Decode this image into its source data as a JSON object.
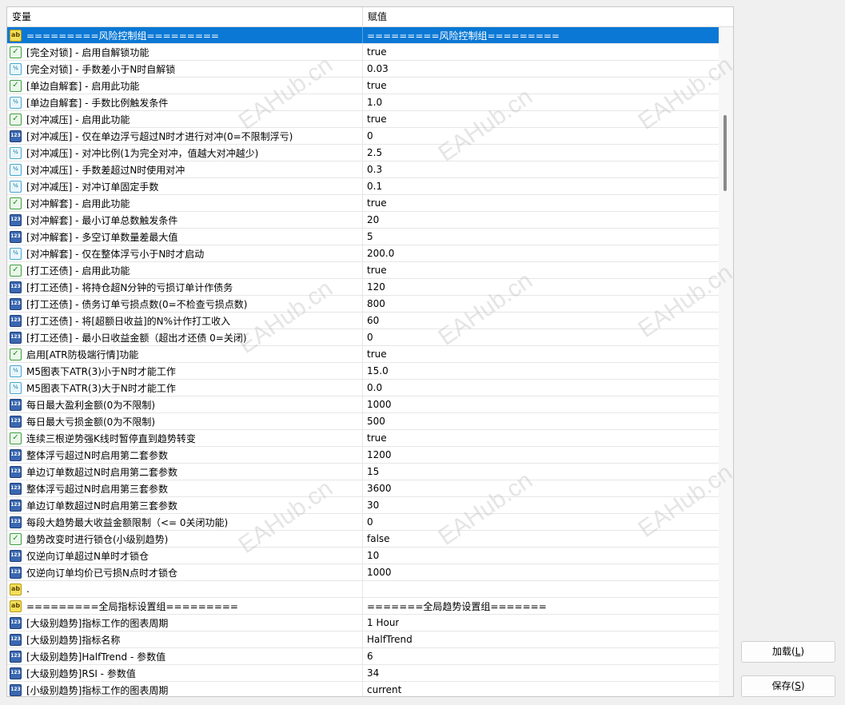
{
  "table": {
    "col_name": "变量",
    "col_value": "赋值",
    "rows": [
      {
        "icon": "ab",
        "name": "=========风险控制组=========",
        "value": "=========风险控制组=========",
        "selected": true
      },
      {
        "icon": "bool",
        "name": "[完全对锁] - 启用自解锁功能",
        "value": "true"
      },
      {
        "icon": "dbl",
        "name": "[完全对锁] - 手数差小于N时自解锁",
        "value": "0.03"
      },
      {
        "icon": "bool",
        "name": "[单边自解套] - 启用此功能",
        "value": "true"
      },
      {
        "icon": "dbl",
        "name": "[单边自解套] - 手数比例触发条件",
        "value": "1.0"
      },
      {
        "icon": "bool",
        "name": "[对冲减压] - 启用此功能",
        "value": "true"
      },
      {
        "icon": "num",
        "name": "[对冲减压] - 仅在单边浮亏超过N时才进行对冲(0=不限制浮亏)",
        "value": "0"
      },
      {
        "icon": "dbl",
        "name": "[对冲减压] - 对冲比例(1为完全对冲，值越大对冲越少)",
        "value": "2.5"
      },
      {
        "icon": "dbl",
        "name": "[对冲减压] - 手数差超过N时使用对冲",
        "value": "0.3"
      },
      {
        "icon": "dbl",
        "name": "[对冲减压] - 对冲订单固定手数",
        "value": "0.1"
      },
      {
        "icon": "bool",
        "name": "[对冲解套] - 启用此功能",
        "value": "true"
      },
      {
        "icon": "num",
        "name": "[对冲解套] - 最小订单总数触发条件",
        "value": "20"
      },
      {
        "icon": "num",
        "name": "[对冲解套] - 多空订单数量差最大值",
        "value": "5"
      },
      {
        "icon": "dbl",
        "name": "[对冲解套] - 仅在整体浮亏小于N时才启动",
        "value": "200.0"
      },
      {
        "icon": "bool",
        "name": "[打工还债] - 启用此功能",
        "value": "true"
      },
      {
        "icon": "num",
        "name": "[打工还债] - 将持仓超N分钟的亏损订单计作债务",
        "value": "120"
      },
      {
        "icon": "num",
        "name": "[打工还债] - 债务订单亏损点数(0=不检查亏损点数)",
        "value": "800"
      },
      {
        "icon": "num",
        "name": "[打工还债] - 将[超额日收益]的N%计作打工收入",
        "value": "60"
      },
      {
        "icon": "num",
        "name": "[打工还债] - 最小日收益金额（超出才还债 0=关闭)",
        "value": "0"
      },
      {
        "icon": "bool",
        "name": "启用[ATR防极端行情]功能",
        "value": "true"
      },
      {
        "icon": "dbl",
        "name": "M5图表下ATR(3)小于N时才能工作",
        "value": "15.0"
      },
      {
        "icon": "dbl",
        "name": "M5图表下ATR(3)大于N时才能工作",
        "value": "0.0"
      },
      {
        "icon": "num",
        "name": "每日最大盈利金额(0为不限制)",
        "value": "1000"
      },
      {
        "icon": "num",
        "name": "每日最大亏损金额(0为不限制)",
        "value": "500"
      },
      {
        "icon": "bool",
        "name": "连续三根逆势强K线时暂停直到趋势转变",
        "value": "true"
      },
      {
        "icon": "num",
        "name": "整体浮亏超过N时启用第二套参数",
        "value": "1200"
      },
      {
        "icon": "num",
        "name": "单边订单数超过N时启用第二套参数",
        "value": "15"
      },
      {
        "icon": "num",
        "name": "整体浮亏超过N时启用第三套参数",
        "value": "3600"
      },
      {
        "icon": "num",
        "name": "单边订单数超过N时启用第三套参数",
        "value": "30"
      },
      {
        "icon": "num",
        "name": "每段大趋势最大收益金额限制（<= 0关闭功能)",
        "value": "0"
      },
      {
        "icon": "bool",
        "name": "趋势改变时进行锁仓(小级别趋势)",
        "value": "false"
      },
      {
        "icon": "num",
        "name": "仅逆向订单超过N单时才锁仓",
        "value": "10"
      },
      {
        "icon": "num",
        "name": "仅逆向订单均价已亏损N点时才锁仓",
        "value": "1000"
      },
      {
        "icon": "ab",
        "name": ".",
        "value": ""
      },
      {
        "icon": "ab",
        "name": "=========全局指标设置组=========",
        "value": "=======全局趋势设置组======="
      },
      {
        "icon": "num",
        "name": "[大级别趋势]指标工作的图表周期",
        "value": "1 Hour"
      },
      {
        "icon": "num",
        "name": "[大级别趋势]指标名称",
        "value": "HalfTrend"
      },
      {
        "icon": "num",
        "name": "[大级别趋势]HalfTrend - 参数值",
        "value": "6"
      },
      {
        "icon": "num",
        "name": "[大级别趋势]RSI - 参数值",
        "value": "34"
      },
      {
        "icon": "num",
        "name": "[小级别趋势]指标工作的图表周期",
        "value": "current"
      }
    ]
  },
  "buttons": {
    "load_label": "加载(",
    "load_key": "L",
    "save_label": "保存(",
    "save_key": "S",
    "close_paren": ")"
  },
  "watermark": "EAHub.cn",
  "icon_glyphs": {
    "ab": "ab",
    "num": "123",
    "dbl": "½",
    "bool": "✓"
  }
}
